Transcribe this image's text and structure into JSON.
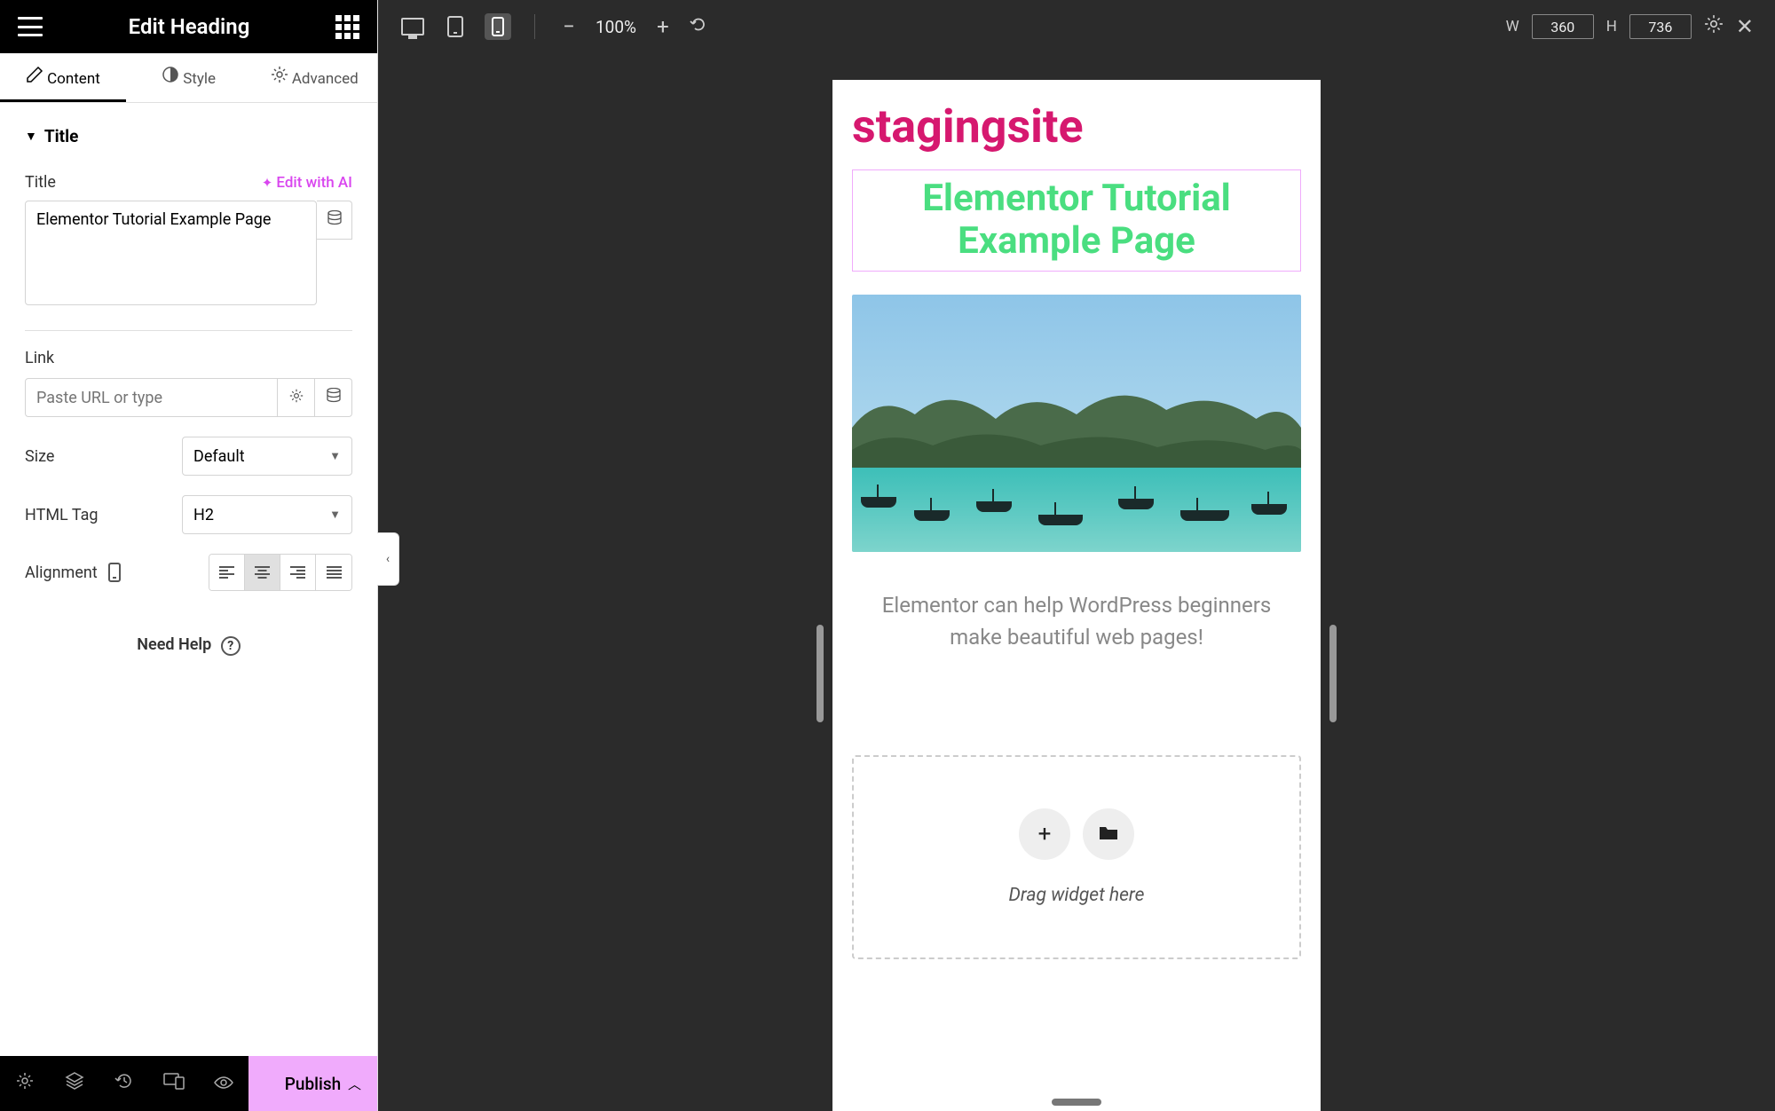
{
  "sidebar": {
    "header_title": "Edit Heading",
    "tabs": {
      "content": "Content",
      "style": "Style",
      "advanced": "Advanced"
    },
    "section_title": "Title",
    "title_label": "Title",
    "edit_ai_label": "Edit with AI",
    "title_value": "Elementor Tutorial Example Page",
    "link_label": "Link",
    "link_placeholder": "Paste URL or type",
    "size_label": "Size",
    "size_value": "Default",
    "htmltag_label": "HTML Tag",
    "htmltag_value": "H2",
    "alignment_label": "Alignment",
    "help_label": "Need Help",
    "publish_label": "Publish"
  },
  "topbar": {
    "zoom": "100%",
    "w_label": "W",
    "w_value": "360",
    "h_label": "H",
    "h_value": "736"
  },
  "canvas": {
    "brand": "stagingsite",
    "heading": "Elementor Tutorial Example Page",
    "paragraph": "Elementor can help WordPress beginners make beautiful web pages!",
    "drop_text": "Drag widget here"
  }
}
